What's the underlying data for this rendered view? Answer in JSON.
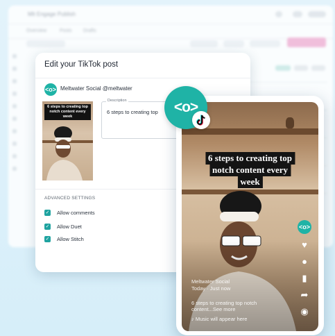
{
  "background_app": {
    "brand_title": "Mlt  Engage  Publish",
    "tabs": [
      "Overview",
      "Posts",
      "Drafts"
    ],
    "filter_label": "Calendar view"
  },
  "dialog": {
    "title": "Edit your TikTok post",
    "account": {
      "logo_glyph": "<o>",
      "name": "Meltwater Social @meltwater"
    },
    "thumbnail_caption": "6 steps to creating top notch content every week",
    "description": {
      "label": "Description",
      "value": "6 steps to creating top"
    },
    "advanced_settings": {
      "heading": "ADVANCED SETTINGS",
      "options": [
        {
          "label": "Allow comments",
          "checked": true
        },
        {
          "label": "Allow Duet",
          "checked": true
        },
        {
          "label": "Allow Stitch",
          "checked": true
        }
      ]
    }
  },
  "badge": {
    "glyph": "<o>",
    "color": "#1fb3a6"
  },
  "phone_preview": {
    "caption_lines": [
      "6 steps to creating top",
      "notch content every",
      "week"
    ],
    "user": "Meltwater Social",
    "time": "Today · Just now",
    "description": "6 steps to creating top notch content...See more",
    "music": "Music will appear here",
    "side_icons": [
      "brand-logo-icon",
      "heart-icon",
      "comment-icon",
      "bookmark-icon",
      "share-icon",
      "music-disc-icon"
    ]
  },
  "colors": {
    "accent": "#1fb3a6",
    "checkbox": "#1fa3a0"
  }
}
